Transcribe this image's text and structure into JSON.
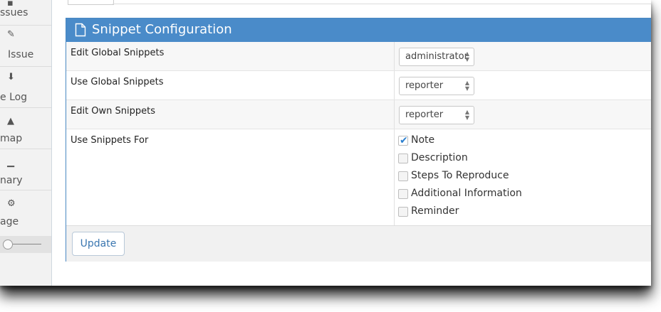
{
  "sidebar": {
    "items": [
      {
        "label": "ssues",
        "icon": "list-icon"
      },
      {
        "label": "Issue",
        "icon": "edit-icon"
      },
      {
        "label": "e Log",
        "icon": "arrow-down-icon"
      },
      {
        "label": "map",
        "icon": "road-icon"
      },
      {
        "label": "nary",
        "icon": "bar-chart-icon"
      },
      {
        "label": "age",
        "icon": "gears-icon"
      }
    ]
  },
  "widget": {
    "title": "Snippet Configuration",
    "icon": "file-icon",
    "header_color": "#4a8bc9"
  },
  "rows": {
    "edit_global": {
      "label": "Edit Global Snippets",
      "value": "administrator"
    },
    "use_global": {
      "label": "Use Global Snippets",
      "value": "reporter"
    },
    "edit_own": {
      "label": "Edit Own Snippets",
      "value": "reporter"
    },
    "use_for": {
      "label": "Use Snippets For",
      "options": [
        {
          "label": "Note",
          "checked": true
        },
        {
          "label": "Description",
          "checked": false
        },
        {
          "label": "Steps To Reproduce",
          "checked": false
        },
        {
          "label": "Additional Information",
          "checked": false
        },
        {
          "label": "Reminder",
          "checked": false
        }
      ]
    }
  },
  "footer": {
    "update_label": "Update"
  }
}
